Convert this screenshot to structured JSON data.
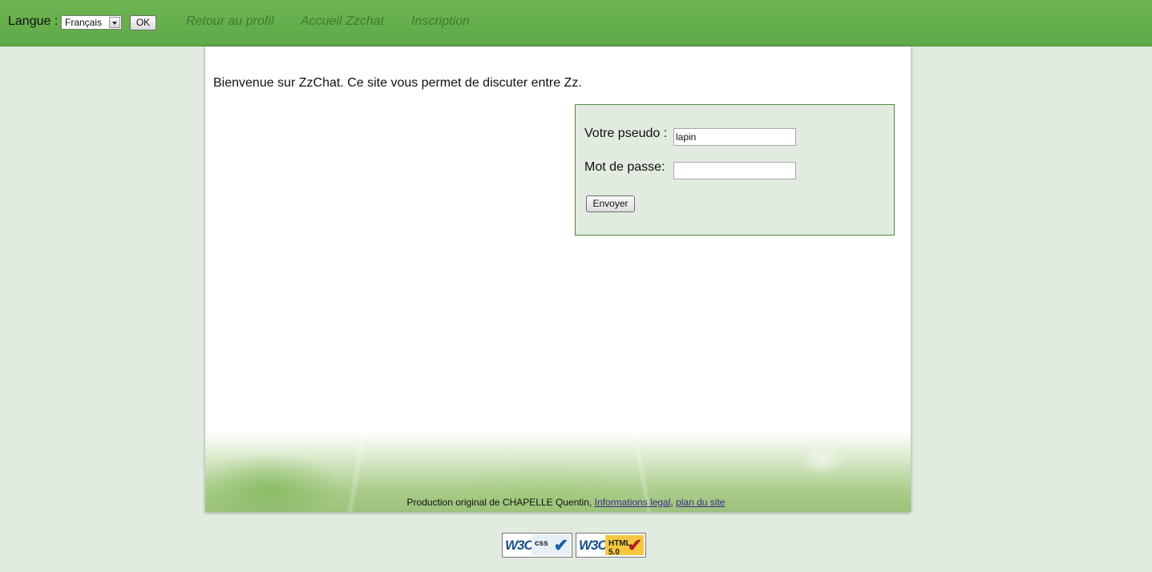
{
  "header": {
    "language_label": "Langue :",
    "language_selected": "Français",
    "ok_label": "OK",
    "nav": [
      {
        "label": "Retour au profil"
      },
      {
        "label": "Accueil Zzchat"
      },
      {
        "label": "Inscription"
      }
    ]
  },
  "main": {
    "welcome": "Bienvenue sur ZzChat. Ce site vous permet de discuter entre Zz.",
    "login": {
      "pseudo_label": "Votre pseudo :",
      "pseudo_value": "lapin",
      "password_label": "Mot de passe:",
      "password_value": "",
      "submit_label": "Envoyer"
    }
  },
  "footer": {
    "credit": "Production original de CHAPELLE Quentin,",
    "legal_link": "Informations legal",
    "separator": ",",
    "sitemap_link": "plan du site"
  },
  "badges": {
    "css": {
      "logo": "W3C",
      "kind": "css"
    },
    "html": {
      "logo": "W3C",
      "kind_line1": "HTML",
      "kind_line2": "5.0"
    }
  },
  "colors": {
    "header_green": "#63ad4c",
    "page_background": "#e2ebe0",
    "nav_link": "#3f7a30",
    "login_border": "#4f8a3d"
  }
}
